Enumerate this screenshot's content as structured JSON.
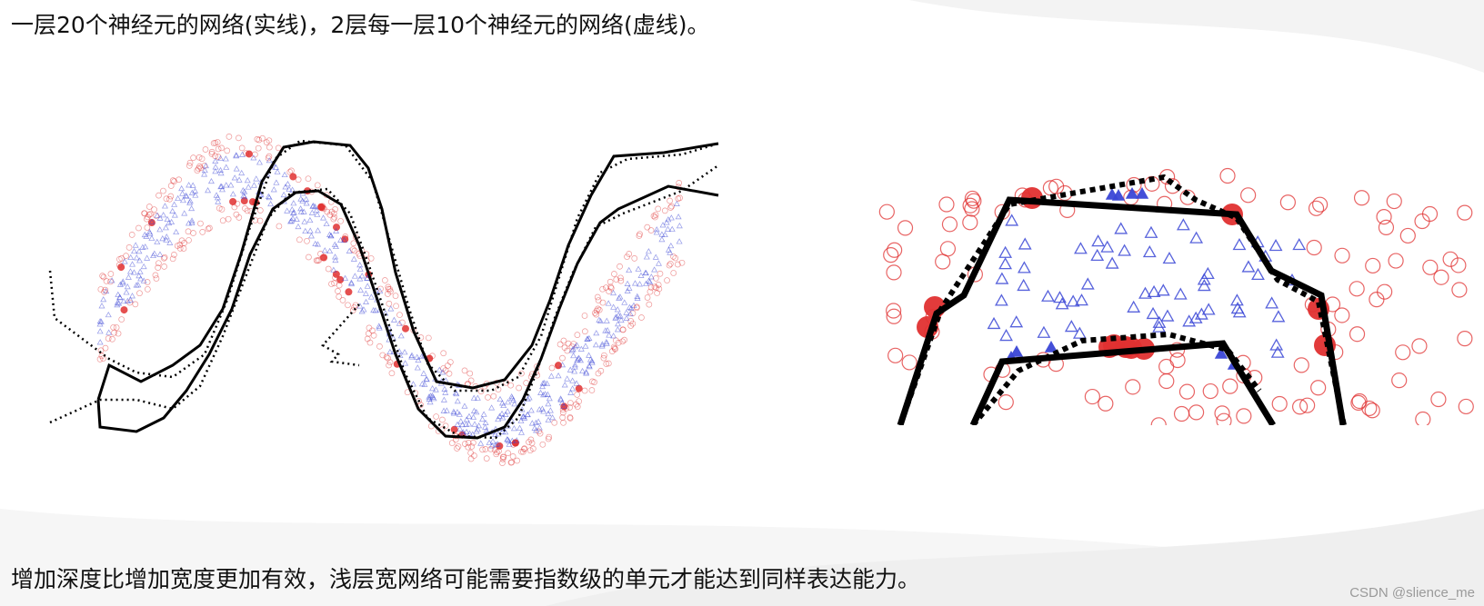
{
  "captions": {
    "top": "一层20个神经元的网络(实线)，2层每一层10个神经元的网络(虚线)。",
    "bottom": "增加深度比增加宽度更加有效，浅层宽网络可能需要指数级的单元才能达到同样表达能力。"
  },
  "watermark": "CSDN @slience_me",
  "colors": {
    "circle_class": "#e03030",
    "triangle_class": "#3a46d6",
    "boundary": "#000000",
    "text": "#111111"
  },
  "figures": {
    "left": {
      "view": "full-sine-decision-boundary"
    },
    "right": {
      "view": "zoomed-decision-boundary"
    }
  }
}
